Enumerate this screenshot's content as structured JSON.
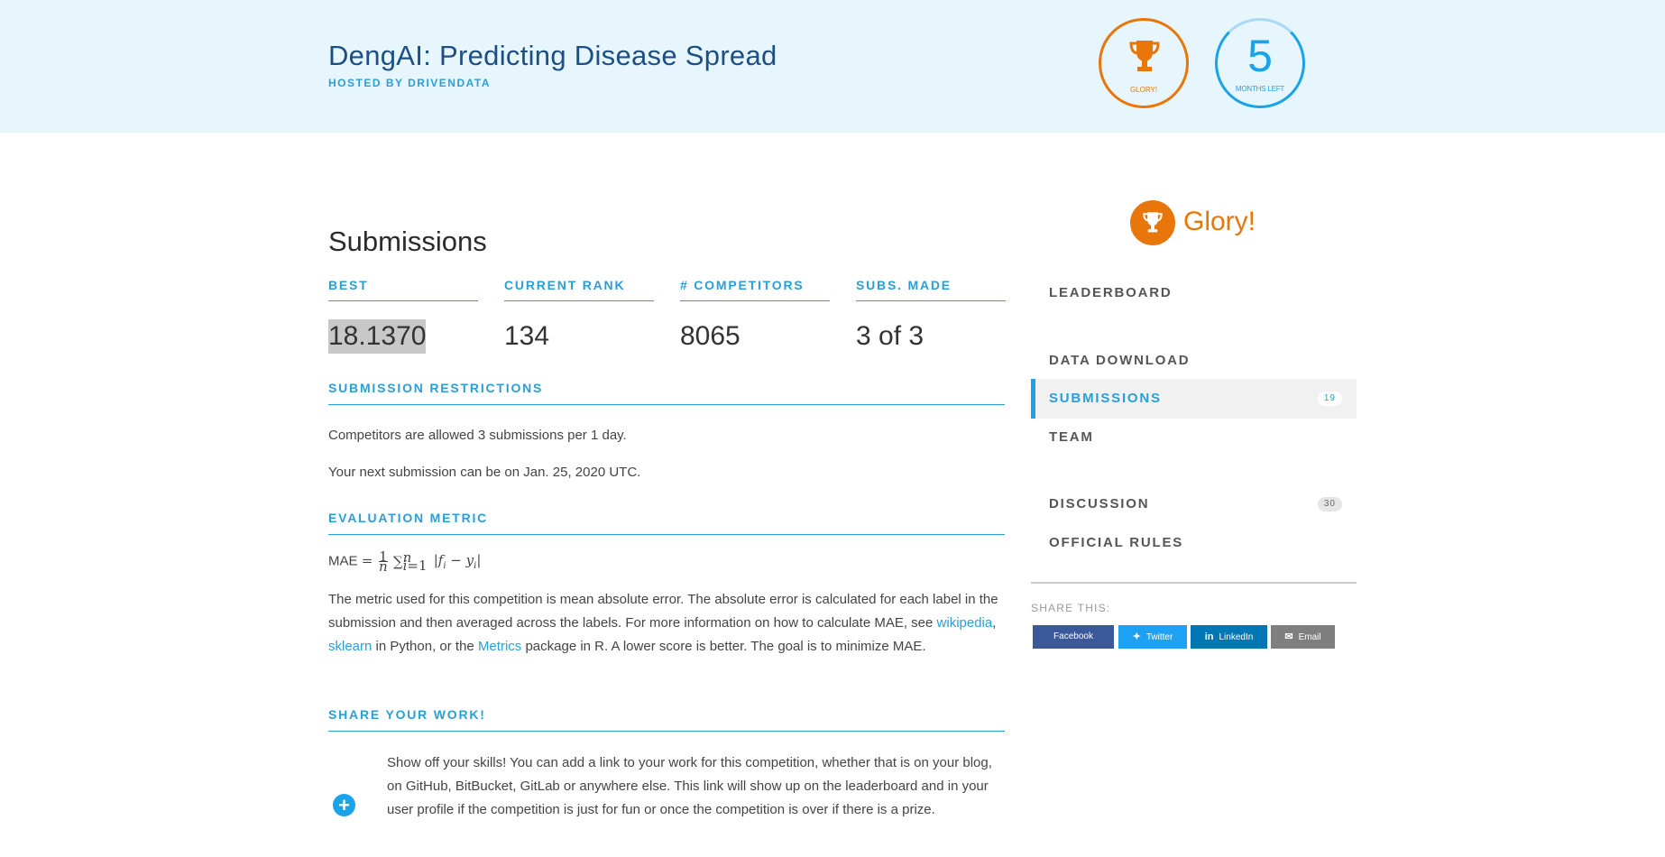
{
  "header": {
    "title": "DengAI: Predicting Disease Spread",
    "host": "HOSTED BY DRIVENDATA",
    "prize_label": "GLORY!",
    "months_value": "5",
    "months_label": "MONTHS LEFT"
  },
  "main": {
    "heading": "Submissions",
    "stats": [
      {
        "label": "BEST",
        "value": "18.1370"
      },
      {
        "label": "CURRENT RANK",
        "value": "134"
      },
      {
        "label": "# COMPETITORS",
        "value": "8065"
      },
      {
        "label": "SUBS. MADE",
        "value": "3 of 3"
      }
    ],
    "restrictions": {
      "heading": "SUBMISSION RESTRICTIONS",
      "line1": "Competitors are allowed 3 submissions per 1 day.",
      "line2": "Your next submission can be on Jan. 25, 2020 UTC."
    },
    "metric": {
      "heading": "EVALUATION METRIC",
      "mae_label": "MAE",
      "text1": "The metric used for this competition is mean absolute error. The absolute error is calculated for each label in the submission and then averaged across the labels. For more information on how to calculate MAE, see ",
      "link1": "wikipedia",
      "sep1": ", ",
      "link2": "sklearn",
      "text2": " in Python, or the ",
      "link3": "Metrics",
      "text3": " package in R. A lower score is better. The goal is to minimize MAE."
    },
    "share_work": {
      "heading": "SHARE YOUR WORK!",
      "text": "Show off your skills! You can add a link to your work for this competition, whether that is on your blog, on GitHub, BitBucket, GitLab or anywhere else. This link will show up on the leaderboard and in your user profile if the competition is just for fun or once the competition is over if there is a prize."
    }
  },
  "sidebar": {
    "prize": "Glory!",
    "nav": [
      {
        "label": "LEADERBOARD",
        "badge": ""
      },
      {
        "label": "DATA DOWNLOAD",
        "badge": ""
      },
      {
        "label": "SUBMISSIONS",
        "badge": "19"
      },
      {
        "label": "TEAM",
        "badge": ""
      },
      {
        "label": "DISCUSSION",
        "badge": "30"
      },
      {
        "label": "OFFICIAL RULES",
        "badge": ""
      }
    ],
    "share_label": "SHARE THIS:",
    "share_buttons": [
      {
        "label": "Facebook",
        "color": "#3b5998"
      },
      {
        "label": "Twitter",
        "color": "#1da1f2"
      },
      {
        "label": "LinkedIn",
        "color": "#0077b5"
      },
      {
        "label": "Email",
        "color": "#7f7f7f"
      }
    ]
  },
  "colors": {
    "accent": "#2a9fd6",
    "prize": "#e8760a",
    "header_bg": "#e6f6fc"
  }
}
